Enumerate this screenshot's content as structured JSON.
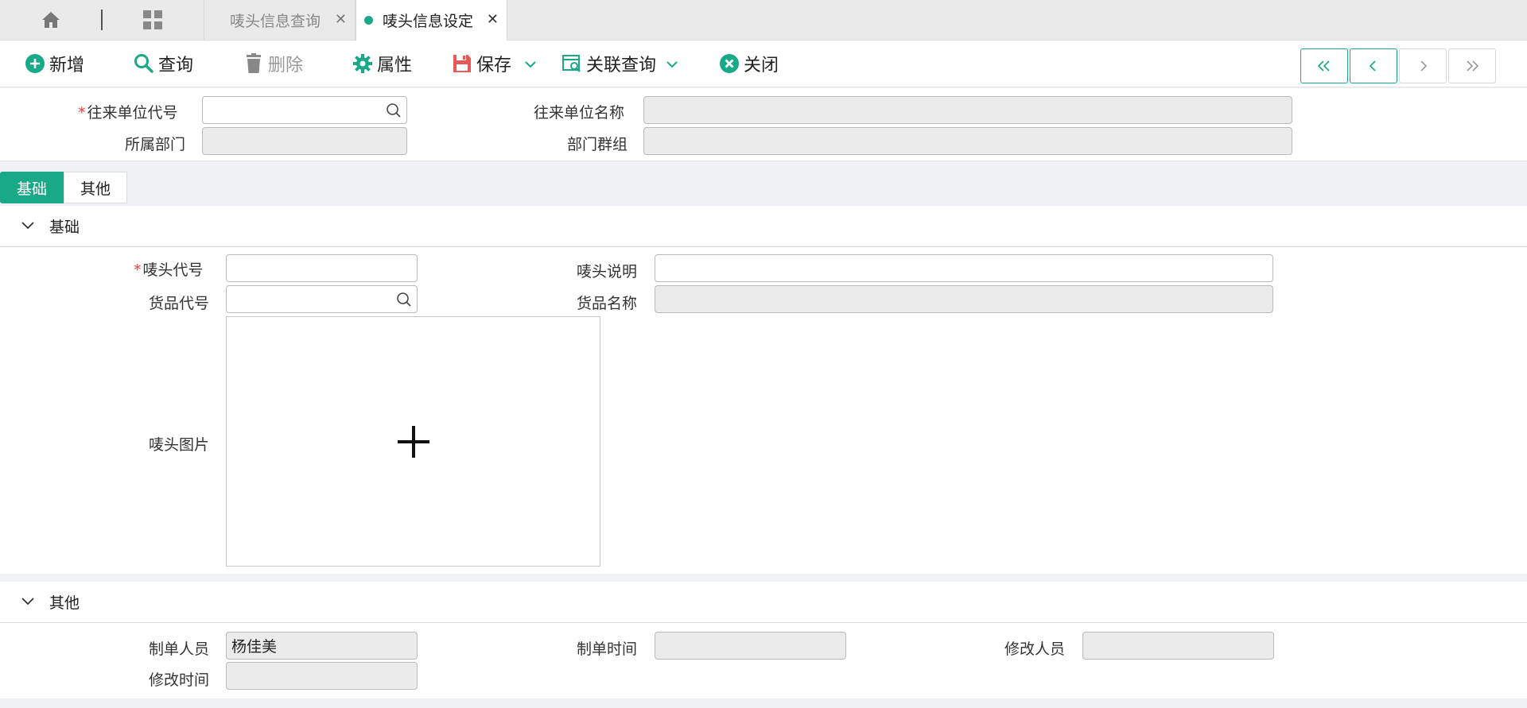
{
  "tabs": [
    {
      "label": "唛头信息查询"
    },
    {
      "label": "唛头信息设定"
    }
  ],
  "toolbar": {
    "add": "新增",
    "query": "查询",
    "delete": "删除",
    "properties": "属性",
    "save": "保存",
    "related_query": "关联查询",
    "close": "关闭"
  },
  "colors": {
    "accent": "#1aa987",
    "required": "#e04646",
    "save_icon": "#e85a5a"
  },
  "header": {
    "partner_code_label": "往来单位代号",
    "partner_name_label": "往来单位名称",
    "department_label": "所属部门",
    "dept_group_label": "部门群组",
    "partner_code": "",
    "partner_name": "",
    "department": "",
    "dept_group": ""
  },
  "section_tabs": [
    "基础",
    "其他"
  ],
  "basic": {
    "title": "基础",
    "mark_code_label": "唛头代号",
    "mark_desc_label": "唛头说明",
    "goods_code_label": "货品代号",
    "goods_name_label": "货品名称",
    "mark_image_label": "唛头图片",
    "mark_code": "",
    "mark_desc": "",
    "goods_code": "",
    "goods_name": ""
  },
  "other": {
    "title": "其他",
    "creator_label": "制单人员",
    "create_time_label": "制单时间",
    "modifier_label": "修改人员",
    "modify_time_label": "修改时间",
    "creator": "杨佳美",
    "create_time": "",
    "modifier": "",
    "modify_time": ""
  }
}
